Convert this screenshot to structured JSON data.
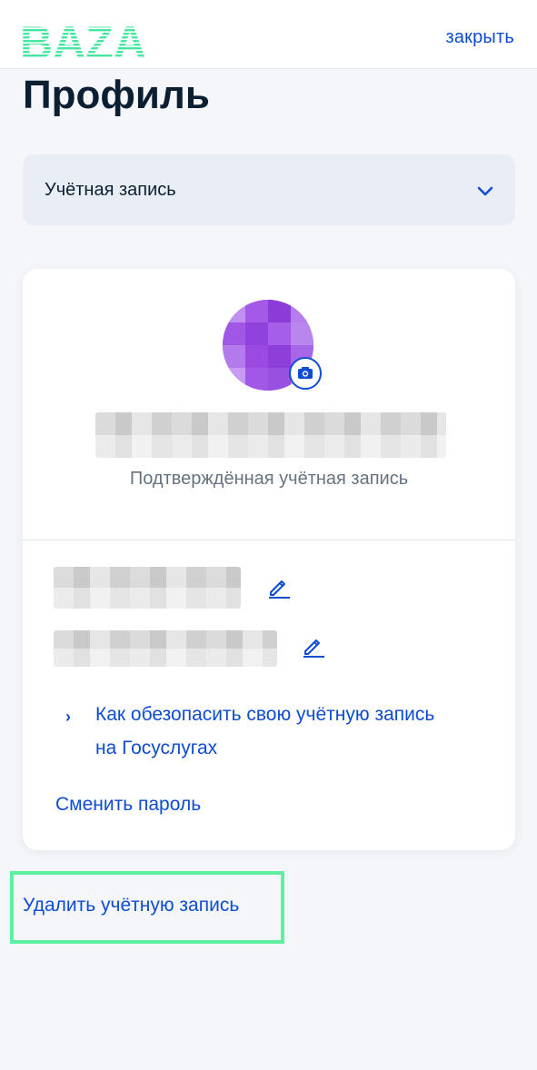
{
  "header": {
    "logo_text": "BAZA",
    "close_label": "закрыть",
    "logo_color": "#47e6a0"
  },
  "page": {
    "title": "Профиль"
  },
  "account_selector": {
    "selected": "Учётная запись",
    "icon": "chevron-down-icon"
  },
  "profile_card": {
    "avatar_icon": "avatar",
    "camera_icon": "camera-icon",
    "status_text": "Подтверждённая учётная запись",
    "edit_icon": "pencil-icon",
    "help_link": "Как обезопасить свою учётную запись на Госуслугах",
    "change_password": "Сменить пароль"
  },
  "footer": {
    "delete_account": "Удалить учётную запись",
    "highlight_color": "#5ef0a1"
  },
  "colors": {
    "accent": "#0d4cd3",
    "text": "#0b1f33",
    "muted": "#66727f",
    "background": "#f4f6fa"
  }
}
